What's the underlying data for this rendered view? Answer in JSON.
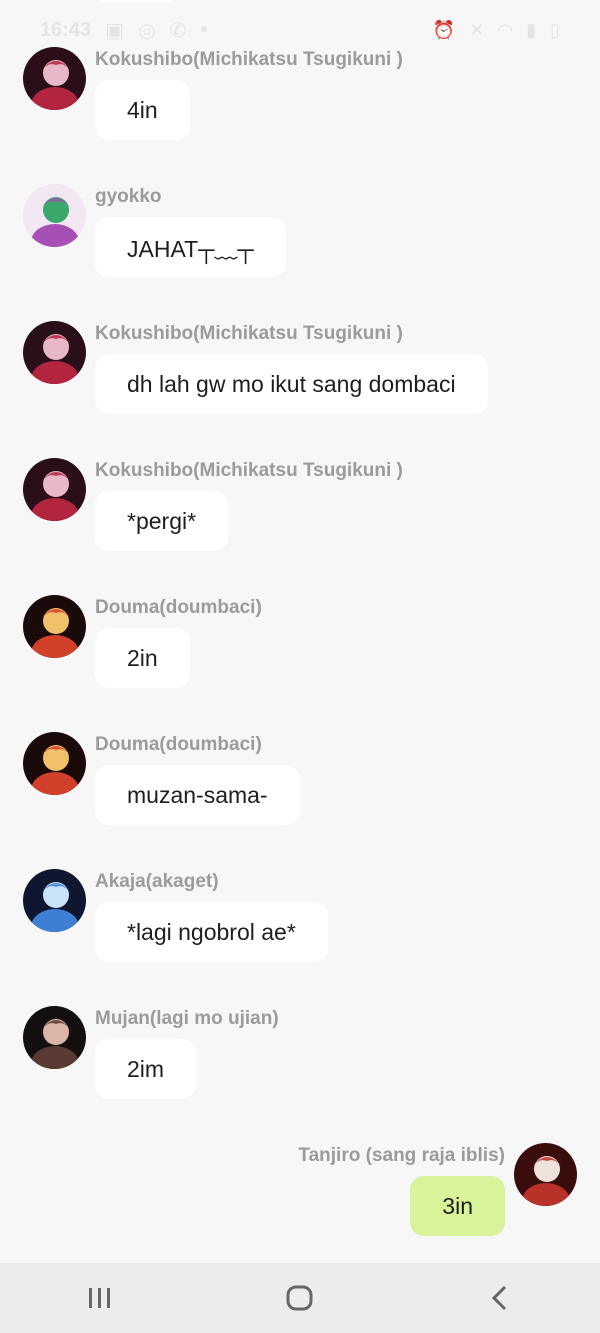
{
  "status_bar": {
    "time": "16:43"
  },
  "messages": [
    {
      "sender": "Kokushibo(Michikatsu Tsugikuni )",
      "text": "4in",
      "avatar": "kokushibo-avatar",
      "colors": [
        "#2a0f1a",
        "#b3243f",
        "#e8b8c8"
      ]
    },
    {
      "sender": "gyokko",
      "text": "JAHAT┬﹏┬",
      "avatar": "gyokko-avatar",
      "colors": [
        "#f2e7f2",
        "#a64fb5",
        "#3aa86b"
      ]
    },
    {
      "sender": "Kokushibo(Michikatsu Tsugikuni )",
      "text": "dh lah gw mo ikut sang dombaci",
      "avatar": "kokushibo-avatar",
      "colors": [
        "#2a0f1a",
        "#b3243f",
        "#e8b8c8"
      ]
    },
    {
      "sender": "Kokushibo(Michikatsu Tsugikuni )",
      "text": "*pergi*",
      "avatar": "kokushibo-avatar",
      "colors": [
        "#2a0f1a",
        "#b3243f",
        "#e8b8c8"
      ]
    },
    {
      "sender": "Douma(doumbaci)",
      "text": "2in",
      "avatar": "douma-avatar",
      "colors": [
        "#1b0a0a",
        "#d2402a",
        "#f0c06a"
      ]
    },
    {
      "sender": "Douma(doumbaci)",
      "text": "muzan-sama-",
      "avatar": "douma-avatar",
      "colors": [
        "#1b0a0a",
        "#d2402a",
        "#f0c06a"
      ]
    },
    {
      "sender": "Akaja(akaget)",
      "text": "*lagi ngobrol ae*",
      "avatar": "akaza-avatar",
      "colors": [
        "#0f1630",
        "#3e7fd6",
        "#c8e2f8"
      ]
    },
    {
      "sender": "Mujan(lagi mo ujian)",
      "text": "2im",
      "avatar": "muzan-avatar",
      "colors": [
        "#141010",
        "#5a3a32",
        "#d9b6a5"
      ]
    }
  ],
  "self_message": {
    "sender": "Tanjiro (sang raja iblis)",
    "text": "3in",
    "avatar": "tanjiro-avatar",
    "colors": [
      "#3a0d0d",
      "#b8322a",
      "#efe2dc"
    ]
  },
  "nav": {
    "recents": "recents-icon",
    "home": "home-icon",
    "back": "back-icon"
  }
}
